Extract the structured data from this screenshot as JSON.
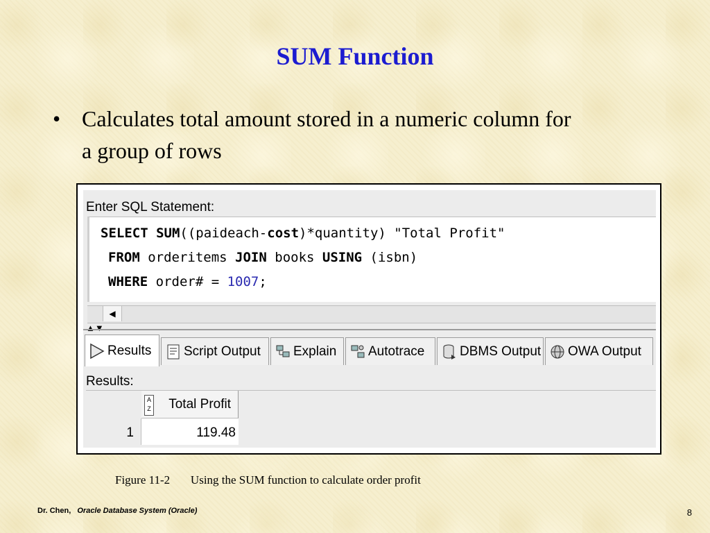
{
  "slide": {
    "title": "SUM Function",
    "bullet_marker": "•",
    "bullet": "Calculates total amount stored in a numeric column for a group of rows",
    "caption_label": "Figure 11-2",
    "caption_text": "Using the SUM function to calculate order profit",
    "footer_author": "Dr. Chen,",
    "footer_course": "Oracle Database System (Oracle)",
    "page_number": "8"
  },
  "sql_panel": {
    "label": "Enter SQL Statement:",
    "line1": {
      "kw1": "SELECT",
      "kw2": "SUM",
      "p1": "((paideach-",
      "kw3": "cost",
      "p2": ")*quantity) \"Total Profit\""
    },
    "line2": {
      "kw1": "FROM",
      "p1": " orderitems ",
      "kw2": "JOIN",
      "p2": " books ",
      "kw3": "USING",
      "p3": " (isbn)"
    },
    "line3": {
      "kw1": "WHERE",
      "p1": " order# = ",
      "num": "1007",
      "p2": ";"
    }
  },
  "tabs": [
    {
      "label": "Results",
      "icon": "play-icon"
    },
    {
      "label": "Script Output",
      "icon": "script-icon"
    },
    {
      "label": "Explain",
      "icon": "explain-icon"
    },
    {
      "label": "Autotrace",
      "icon": "autotrace-icon"
    },
    {
      "label": "DBMS Output",
      "icon": "dbms-icon"
    },
    {
      "label": "OWA Output",
      "icon": "owa-icon"
    }
  ],
  "results": {
    "label": "Results:",
    "column": "Total Profit",
    "sort_glyph": "A Z",
    "row_number": "1",
    "value": "119.48"
  },
  "colors": {
    "title": "#1c1cd0",
    "background": "#f6efcf",
    "number_literal": "#2a2ab0"
  }
}
